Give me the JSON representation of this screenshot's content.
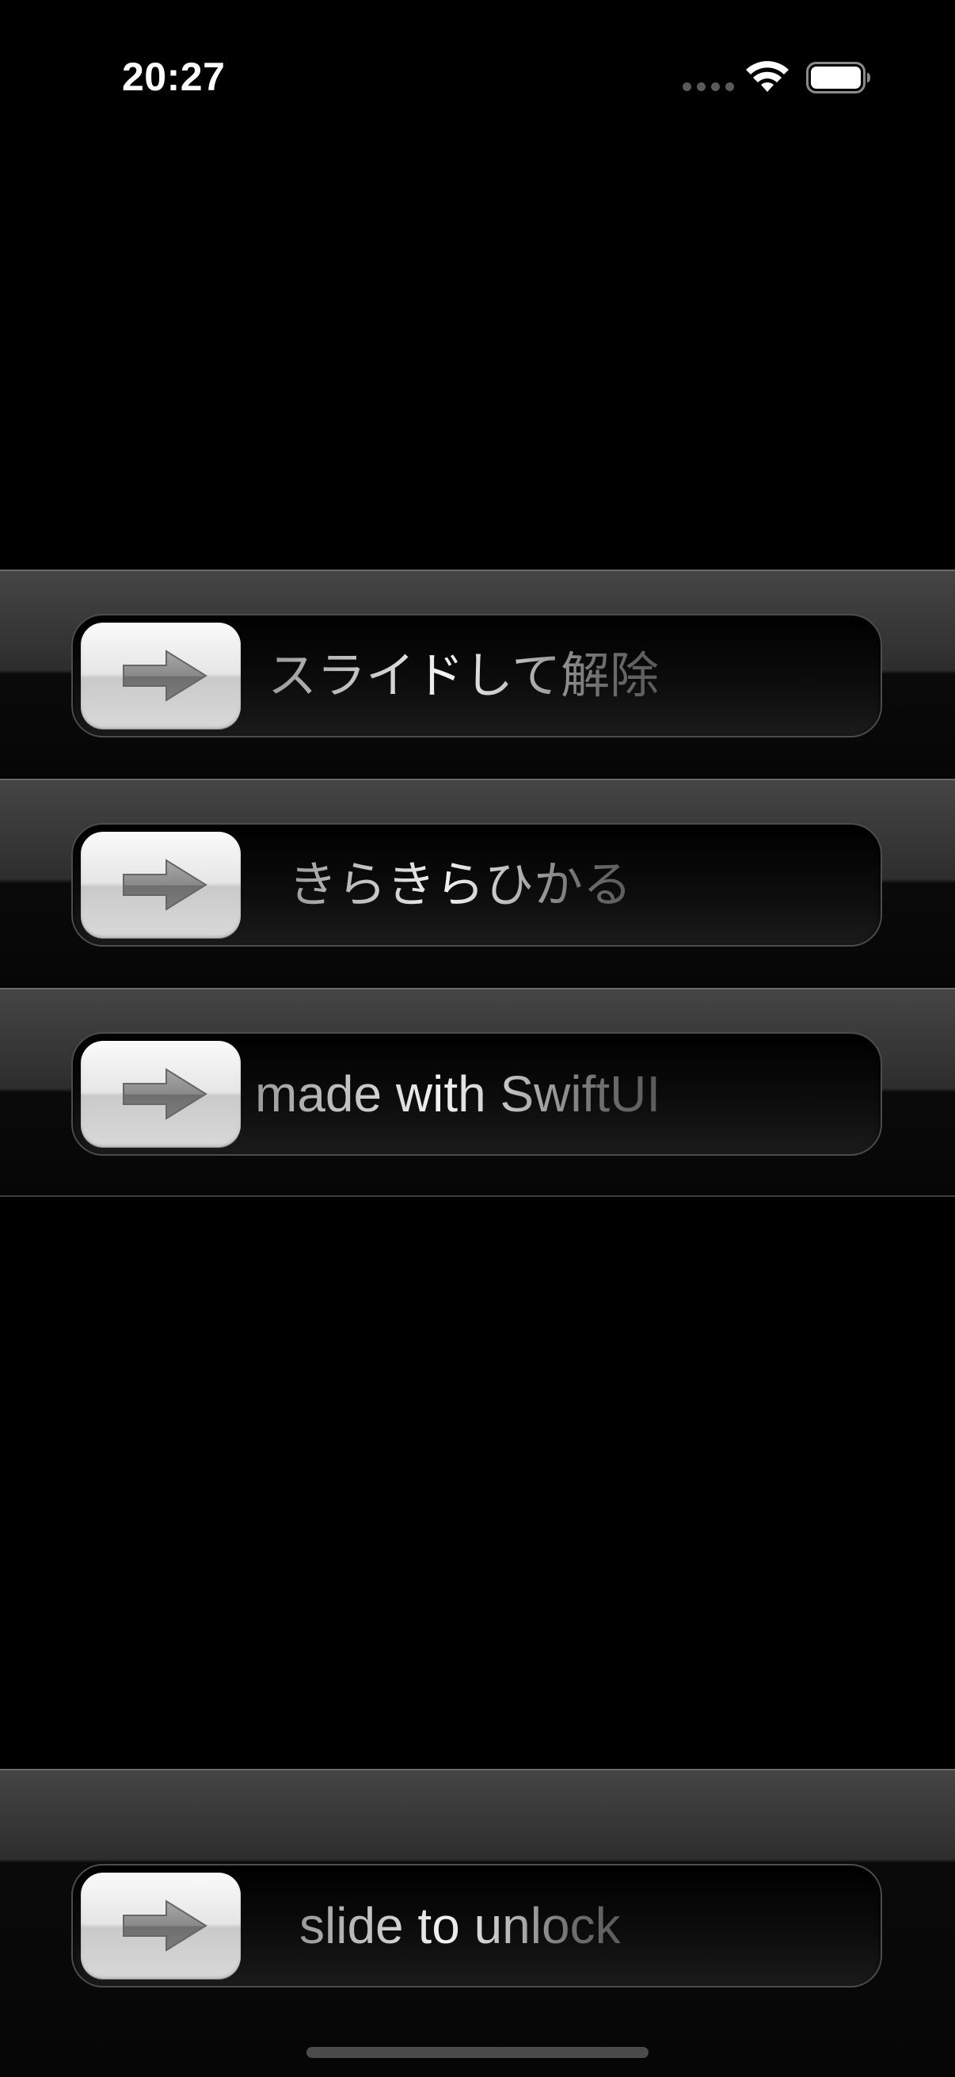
{
  "status_bar": {
    "time": "20:27"
  },
  "sliders": [
    {
      "label": "スライドして解除",
      "icon": "arrow-right-icon"
    },
    {
      "label": "きらきらひかる",
      "icon": "arrow-right-icon"
    },
    {
      "label": "made with SwiftUI",
      "icon": "arrow-right-icon"
    },
    {
      "label": "slide to unlock",
      "icon": "arrow-right-icon"
    }
  ],
  "colors": {
    "background": "#000000",
    "band_top": "#454545",
    "knob_light": "#fafafa",
    "text_highlight": "#f4f4f4"
  }
}
